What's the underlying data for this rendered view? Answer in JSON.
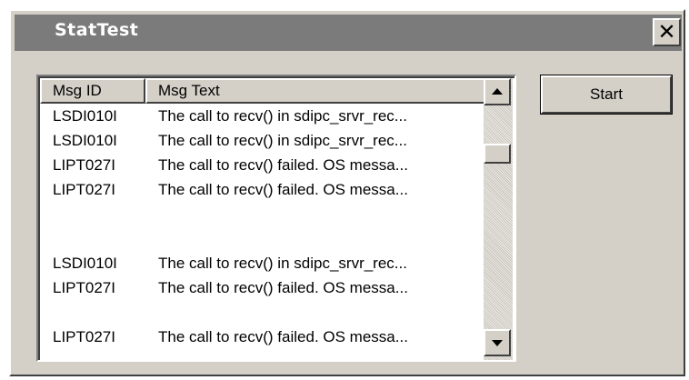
{
  "window": {
    "title": "StatTest",
    "close_label": "✕"
  },
  "list": {
    "columns": [
      {
        "label": "Msg ID"
      },
      {
        "label": "Msg Text"
      }
    ],
    "rows": [
      {
        "id": "LSDI010I",
        "text": "The call to recv() in sdipc_srvr_rec..."
      },
      {
        "id": "LSDI010I",
        "text": "The call to recv() in sdipc_srvr_rec..."
      },
      {
        "id": "LIPT027I",
        "text": "The call to recv() failed.  OS messa..."
      },
      {
        "id": "LIPT027I",
        "text": "The call to recv() failed.  OS messa..."
      },
      {
        "id": "",
        "text": ""
      },
      {
        "id": "",
        "text": ""
      },
      {
        "id": "LSDI010I",
        "text": "The call to recv() in sdipc_srvr_rec..."
      },
      {
        "id": "LIPT027I",
        "text": "The call to recv() failed.  OS messa..."
      },
      {
        "id": "",
        "text": ""
      },
      {
        "id": "LIPT027I",
        "text": "The call to recv() failed.  OS messa..."
      }
    ]
  },
  "buttons": {
    "start_label": "Start"
  },
  "icons": {
    "close": "close-icon",
    "scroll_up": "arrow-up-icon",
    "scroll_down": "arrow-down-icon"
  }
}
